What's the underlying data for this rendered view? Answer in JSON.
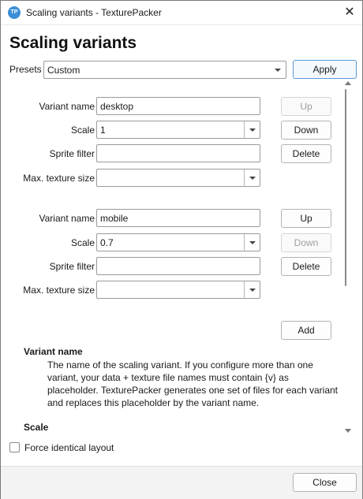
{
  "window": {
    "title": "Scaling variants - TexturePacker",
    "app_icon_text": "TP",
    "close_glyph": "✕"
  },
  "heading": "Scaling variants",
  "presets": {
    "label": "Presets",
    "value": "Custom",
    "apply_label": "Apply"
  },
  "variants": [
    {
      "name_label": "Variant name",
      "name_value": "desktop",
      "scale_label": "Scale",
      "scale_value": "1",
      "filter_label": "Sprite filter",
      "filter_value": "",
      "max_label": "Max. texture size",
      "max_value": "",
      "up_label": "Up",
      "up_enabled": false,
      "down_label": "Down",
      "down_enabled": true,
      "delete_label": "Delete"
    },
    {
      "name_label": "Variant name",
      "name_value": "mobile",
      "scale_label": "Scale",
      "scale_value": "0.7",
      "filter_label": "Sprite filter",
      "filter_value": "",
      "max_label": "Max. texture size",
      "max_value": "",
      "up_label": "Up",
      "up_enabled": true,
      "down_label": "Down",
      "down_enabled": false,
      "delete_label": "Delete"
    }
  ],
  "add_label": "Add",
  "help": {
    "title": "Variant name",
    "text": "The name of the scaling variant. If you configure more than one variant, your data + texture file names must contain {v} as placeholder. TexturePacker generates one set of files for each variant and replaces this placeholder by the variant name.",
    "next_title": "Scale"
  },
  "force_identical": {
    "label": "Force identical layout",
    "checked": false
  },
  "close_label": "Close",
  "colors": {
    "accent_border": "#5a9ad6",
    "app_icon": "#3a8fd6"
  }
}
